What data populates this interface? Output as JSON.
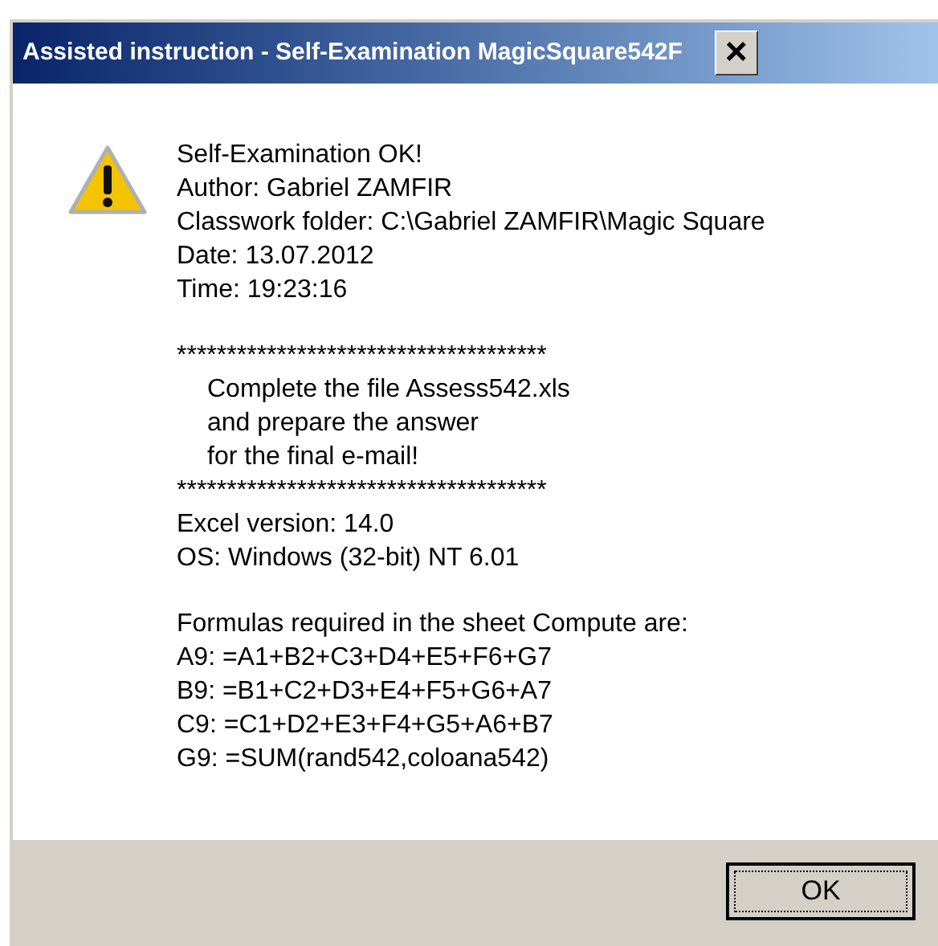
{
  "window": {
    "title": "Assisted instruction - Self-Examination MagicSquare542F",
    "close_label": "×"
  },
  "message": {
    "blocks": [
      {
        "lines": [
          {
            "kind": "plain",
            "text": "Self-Examination OK!"
          },
          {
            "kind": "plain",
            "text": "Author: Gabriel ZAMFIR"
          },
          {
            "kind": "plain",
            "text": "Classwork folder: C:\\Gabriel ZAMFIR\\Magic Square"
          },
          {
            "kind": "plain",
            "text": "Date: 13.07.2012"
          },
          {
            "kind": "plain",
            "text": "Time: 19:23:16"
          }
        ]
      },
      {
        "lines": [
          {
            "kind": "plain",
            "text": "*************************************"
          },
          {
            "kind": "indented",
            "text": "Complete the file Assess542.xls"
          },
          {
            "kind": "indented",
            "text": "and prepare the answer"
          },
          {
            "kind": "indented",
            "text": "for the final e-mail!"
          },
          {
            "kind": "plain",
            "text": "*************************************"
          },
          {
            "kind": "plain",
            "text": "Excel version: 14.0"
          },
          {
            "kind": "plain",
            "text": "OS: Windows (32-bit) NT 6.01"
          }
        ]
      },
      {
        "lines": [
          {
            "kind": "plain",
            "text": "Formulas required in the sheet Compute are:"
          },
          {
            "kind": "plain",
            "text": "A9: =A1+B2+C3+D4+E5+F6+G7"
          },
          {
            "kind": "plain",
            "text": "B9: =B1+C2+D3+E4+F5+G6+A7"
          },
          {
            "kind": "plain",
            "text": "C9: =C1+D2+E3+F4+G5+A6+B7"
          },
          {
            "kind": "plain",
            "text": "G9: =SUM(rand542,coloana542)"
          }
        ]
      }
    ]
  },
  "buttons": [
    "OK"
  ]
}
